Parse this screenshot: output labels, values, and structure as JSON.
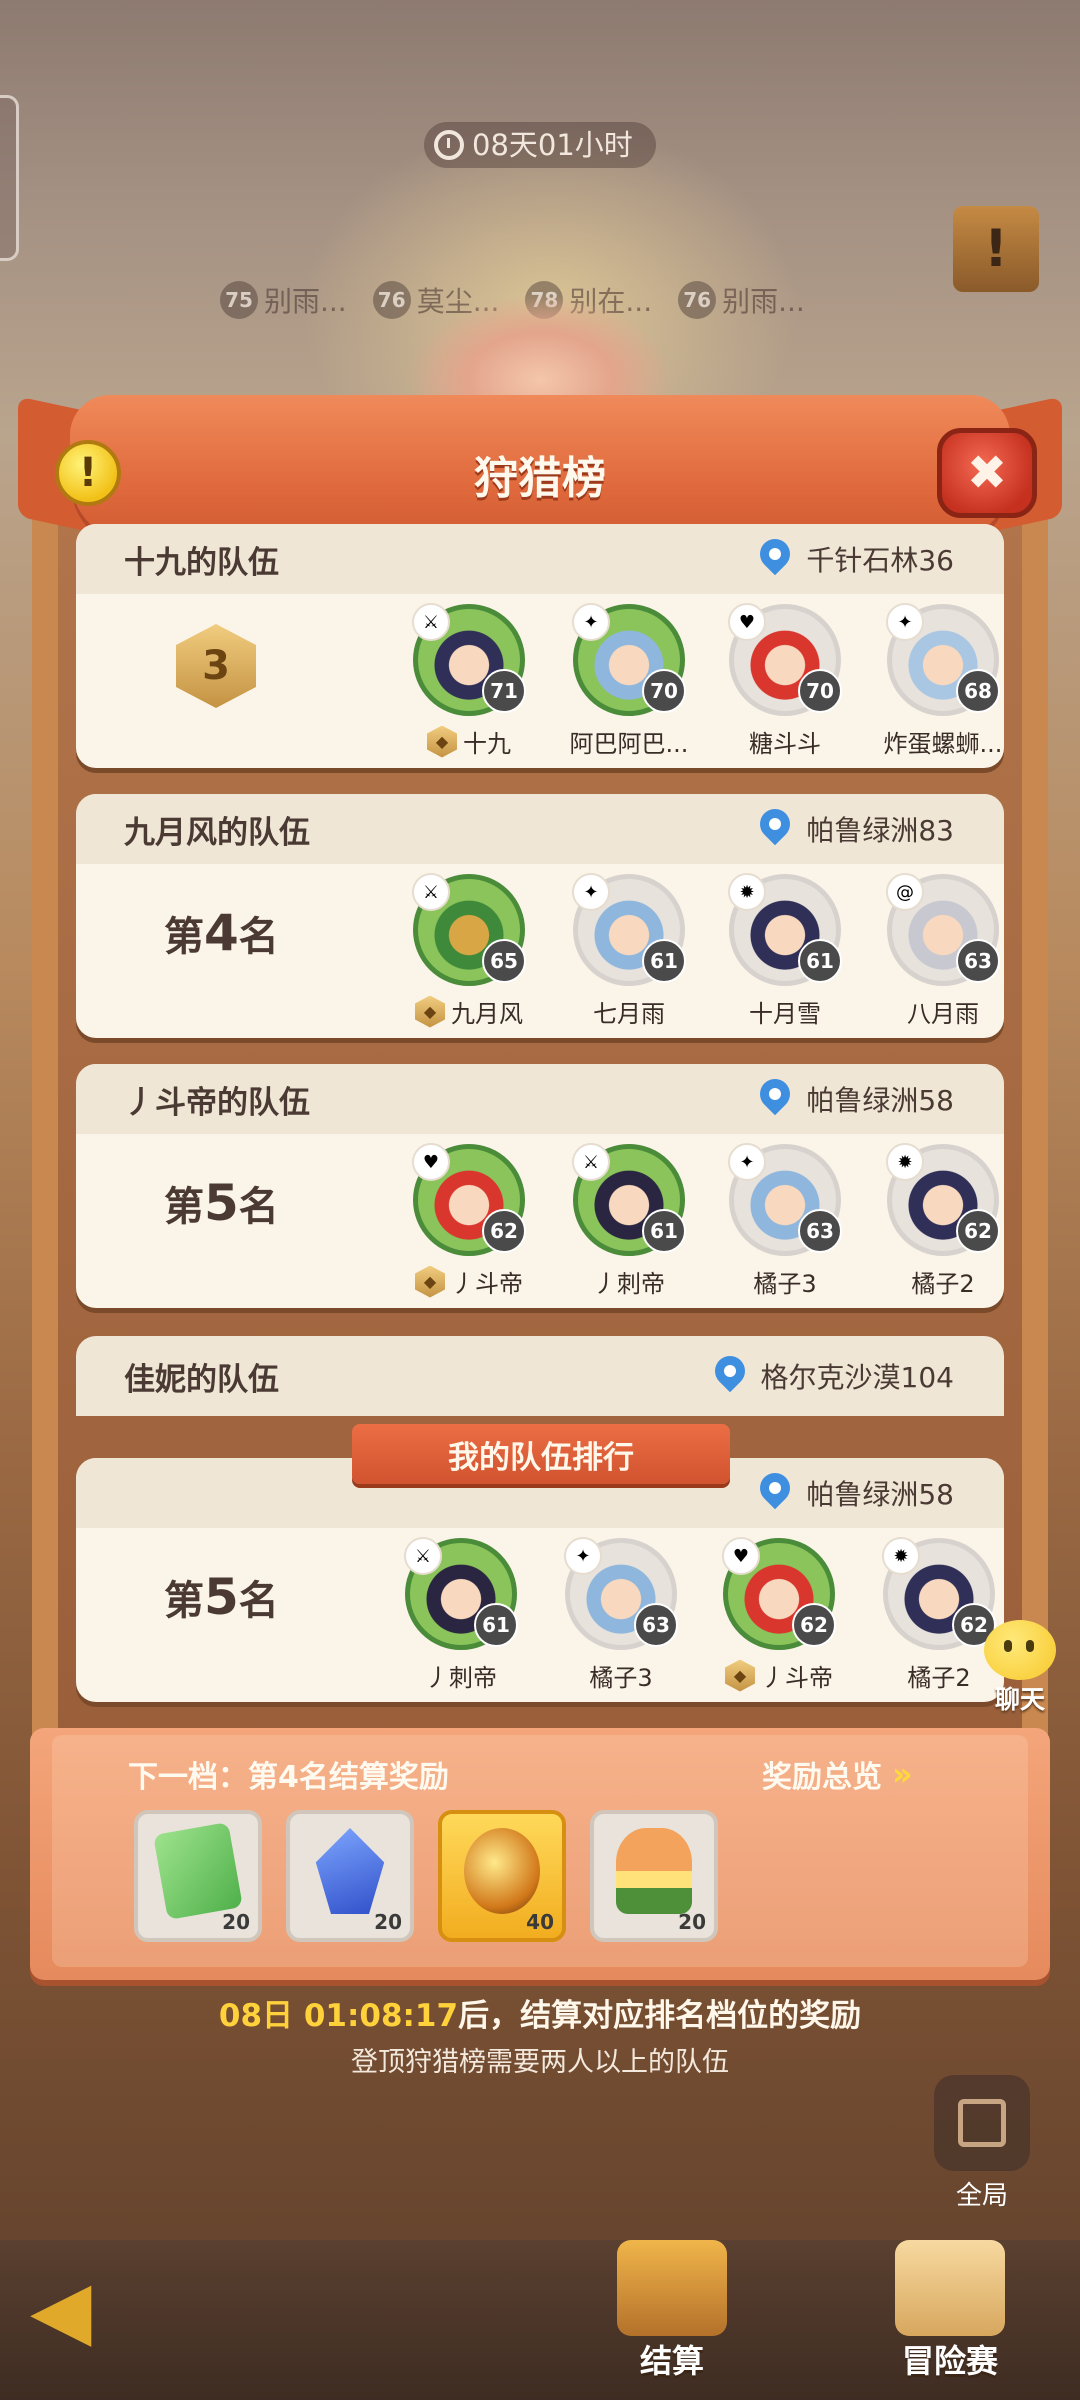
{
  "top_timer": "08天01小时",
  "bg_players": [
    {
      "level": "75",
      "name": "别雨..."
    },
    {
      "level": "76",
      "name": "莫尘..."
    },
    {
      "level": "78",
      "name": "别在..."
    },
    {
      "level": "76",
      "name": "别雨..."
    }
  ],
  "title": "狩猎榜",
  "info_icon": "!",
  "close_icon": "✖",
  "teams": [
    {
      "name": "十九的队伍",
      "location": "千针石林36",
      "rank_badge": "3",
      "members": [
        {
          "name": "十九",
          "level": "71",
          "leader": true,
          "class_icon": "sword-icon"
        },
        {
          "name": "阿巴阿巴...",
          "level": "70",
          "leader": false,
          "class_icon": "magic-icon"
        },
        {
          "name": "糖斗斗",
          "level": "70",
          "leader": false,
          "class_icon": "heart-icon"
        },
        {
          "name": "炸蛋螺蛳...",
          "level": "68",
          "leader": false,
          "class_icon": "magic-icon"
        }
      ]
    },
    {
      "name": "九月风的队伍",
      "location": "帕鲁绿洲83",
      "rank_prefix": "第",
      "rank_num": "4",
      "rank_suffix": "名",
      "members": [
        {
          "name": "九月风",
          "level": "65",
          "leader": true,
          "class_icon": "sword-icon"
        },
        {
          "name": "七月雨",
          "level": "61",
          "leader": false,
          "class_icon": "magic-icon"
        },
        {
          "name": "十月雪",
          "level": "61",
          "leader": false,
          "class_icon": "fire-icon"
        },
        {
          "name": "八月雨",
          "level": "63",
          "leader": false,
          "class_icon": "spiral-icon"
        }
      ]
    },
    {
      "name": "丿斗帝的队伍",
      "location": "帕鲁绿洲58",
      "rank_prefix": "第",
      "rank_num": "5",
      "rank_suffix": "名",
      "members": [
        {
          "name": "丿斗帝",
          "level": "62",
          "leader": true,
          "class_icon": "heart-icon"
        },
        {
          "name": "丿刺帝",
          "level": "61",
          "leader": false,
          "class_icon": "sword-icon"
        },
        {
          "name": "橘子3",
          "level": "63",
          "leader": false,
          "class_icon": "magic-icon"
        },
        {
          "name": "橘子2",
          "level": "62",
          "leader": false,
          "class_icon": "fire-icon"
        }
      ]
    }
  ],
  "partial_team": {
    "name": "佳妮的队伍",
    "location": "格尔克沙漠104"
  },
  "my_team_banner": "我的队伍排行",
  "my_team": {
    "location": "帕鲁绿洲58",
    "rank_prefix": "第",
    "rank_num": "5",
    "rank_suffix": "名",
    "members": [
      {
        "name": "丿刺帝",
        "level": "61",
        "leader": false,
        "class_icon": "sword-icon"
      },
      {
        "name": "橘子3",
        "level": "63",
        "leader": false,
        "class_icon": "magic-icon"
      },
      {
        "name": "丿斗帝",
        "level": "62",
        "leader": true,
        "class_icon": "heart-icon"
      },
      {
        "name": "橘子2",
        "level": "62",
        "leader": false,
        "class_icon": "fire-icon"
      }
    ]
  },
  "reward": {
    "next_tier": "下一档：第4名结算奖励",
    "overview": "奖励总览",
    "items": [
      {
        "icon": "green-ticket-icon",
        "count": "20"
      },
      {
        "icon": "blue-crystal-icon",
        "count": "20"
      },
      {
        "icon": "golden-egg-icon",
        "count": "40"
      },
      {
        "icon": "food-plate-icon",
        "count": "20"
      }
    ]
  },
  "settle_time": "08日 01:08:17",
  "settle_text": "后，结算对应排名档位的奖励",
  "sub_note": "登顶狩猎榜需要两人以上的队伍",
  "chat_label": "聊天",
  "global_label": "全局",
  "nav": {
    "settle": "结算",
    "adventure": "冒险赛"
  },
  "colors": {
    "accent": "#e06a3d",
    "gold": "#ffd13a",
    "pin": "#3f8fe0"
  }
}
